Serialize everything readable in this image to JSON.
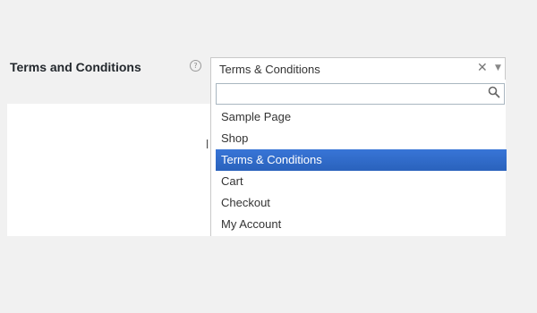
{
  "setting": {
    "label": "Terms and Conditions",
    "help_icon": "question-circle-icon",
    "help_glyph": "?"
  },
  "select": {
    "selected_value": "Terms & Conditions",
    "clear_glyph": "✕",
    "chevron_glyph": "▼",
    "search_placeholder": "",
    "options": [
      {
        "label": "Sample Page"
      },
      {
        "label": "Shop"
      },
      {
        "label": "Terms & Conditions",
        "highlighted": true
      },
      {
        "label": "Cart"
      },
      {
        "label": "Checkout"
      },
      {
        "label": "My Account"
      }
    ]
  },
  "stray_text": "l",
  "colors": {
    "highlight": "#3875d7",
    "page_background": "#f1f1f1"
  }
}
